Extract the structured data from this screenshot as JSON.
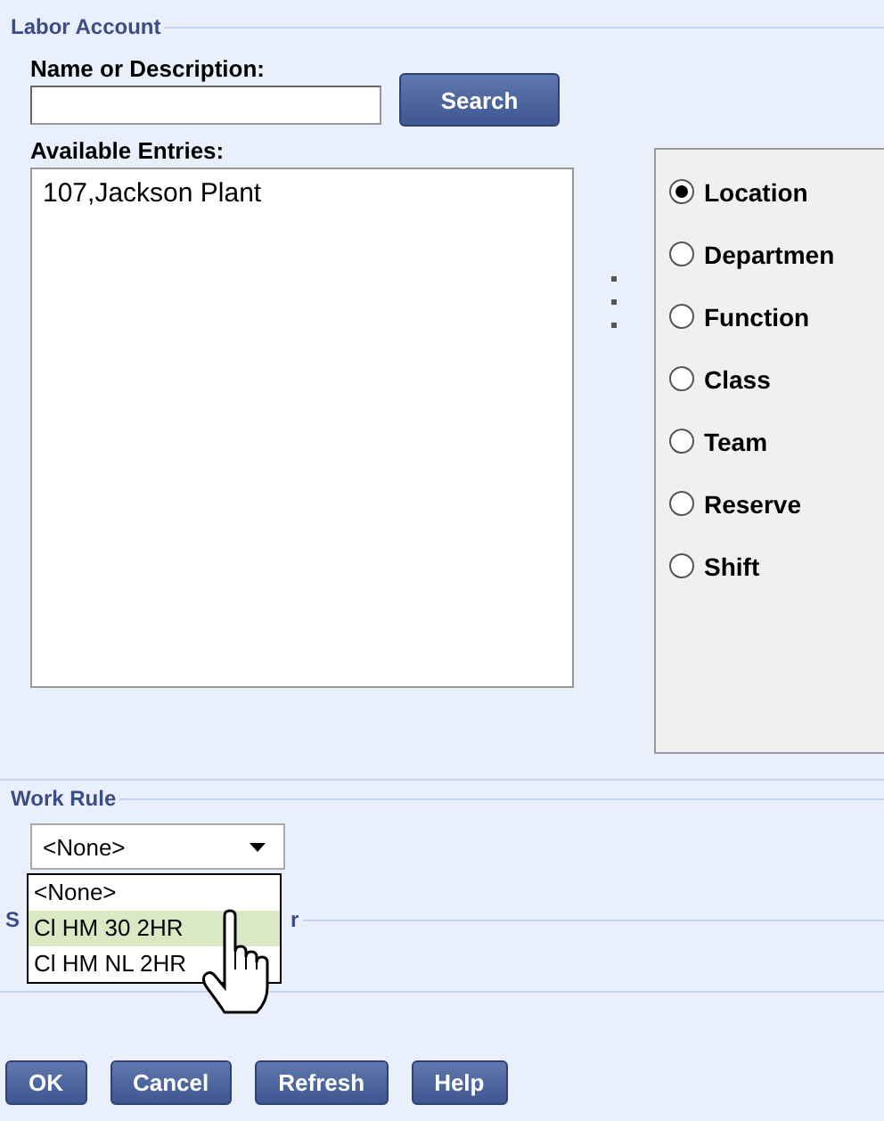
{
  "labor_account": {
    "title": "Labor Account",
    "name_label": "Name or Description:",
    "search_button": "Search",
    "entries_label": "Available Entries:",
    "entries": [
      {
        "label": "107,Jackson Plant",
        "selected": false
      }
    ],
    "levels": [
      {
        "label": "Location",
        "selected": true
      },
      {
        "label": "Departmen",
        "selected": false
      },
      {
        "label": "Function",
        "selected": false
      },
      {
        "label": "Class",
        "selected": false
      },
      {
        "label": "Team",
        "selected": false
      },
      {
        "label": "Reserve",
        "selected": false
      },
      {
        "label": "Shift",
        "selected": false
      }
    ]
  },
  "work_rule": {
    "title": "Work Rule",
    "value": "<None>",
    "dropdown_open": true,
    "options": [
      {
        "label": "<None>",
        "highlighted": false
      },
      {
        "label": "Cl HM 30 2HR",
        "highlighted": true
      },
      {
        "label": "Cl HM NL 2HR",
        "highlighted": false
      }
    ]
  },
  "next_section": {
    "label_start": "S",
    "label_end": "r"
  },
  "buttons": [
    "OK",
    "Cancel",
    "Refresh",
    "Help"
  ]
}
